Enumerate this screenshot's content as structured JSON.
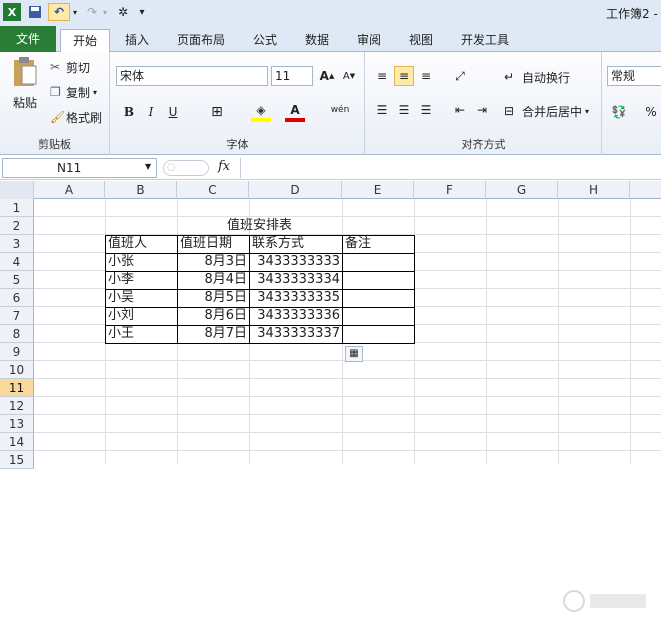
{
  "window": {
    "title": "工作簿2 -"
  },
  "tabs": [
    "文件",
    "开始",
    "插入",
    "页面布局",
    "公式",
    "数据",
    "审阅",
    "视图",
    "开发工具"
  ],
  "clipboard": {
    "paste": "粘贴",
    "cut": "剪切",
    "copy": "复制",
    "format_painter": "格式刷",
    "label": "剪贴板"
  },
  "font": {
    "name": "宋体",
    "size": "11",
    "bold": "B",
    "italic": "I",
    "underline": "U",
    "color_a": "A",
    "wen": "wén",
    "label": "字体"
  },
  "align": {
    "wrap": "自动换行",
    "merge": "合并后居中",
    "label": "对齐方式"
  },
  "number": {
    "format": "常规",
    "percent": "%",
    "label": "数"
  },
  "formula": {
    "name_box": "N11",
    "fx": "fx",
    "content": ""
  },
  "columns": [
    "A",
    "B",
    "C",
    "D",
    "E",
    "F",
    "G",
    "H"
  ],
  "rows": [
    "1",
    "2",
    "3",
    "4",
    "5",
    "6",
    "7",
    "8",
    "9",
    "10",
    "11",
    "12",
    "13",
    "14",
    "15"
  ],
  "selected_row": "11",
  "sheet": {
    "title": "值班安排表",
    "headers": [
      "值班人",
      "值班日期",
      "联系方式",
      "备注"
    ],
    "records": [
      {
        "name": "小张",
        "date": "8月3日",
        "phone": "3433333333",
        "note": ""
      },
      {
        "name": "小李",
        "date": "8月4日",
        "phone": "3433333334",
        "note": ""
      },
      {
        "name": "小吴",
        "date": "8月5日",
        "phone": "3433333335",
        "note": ""
      },
      {
        "name": "小刘",
        "date": "8月6日",
        "phone": "3433333336",
        "note": ""
      },
      {
        "name": "小王",
        "date": "8月7日",
        "phone": "3433333337",
        "note": ""
      }
    ]
  },
  "colors": {
    "file_tab": "#2a7d36",
    "ribbon_bg": "#dfe9f5",
    "selection": "#f9d99b"
  }
}
